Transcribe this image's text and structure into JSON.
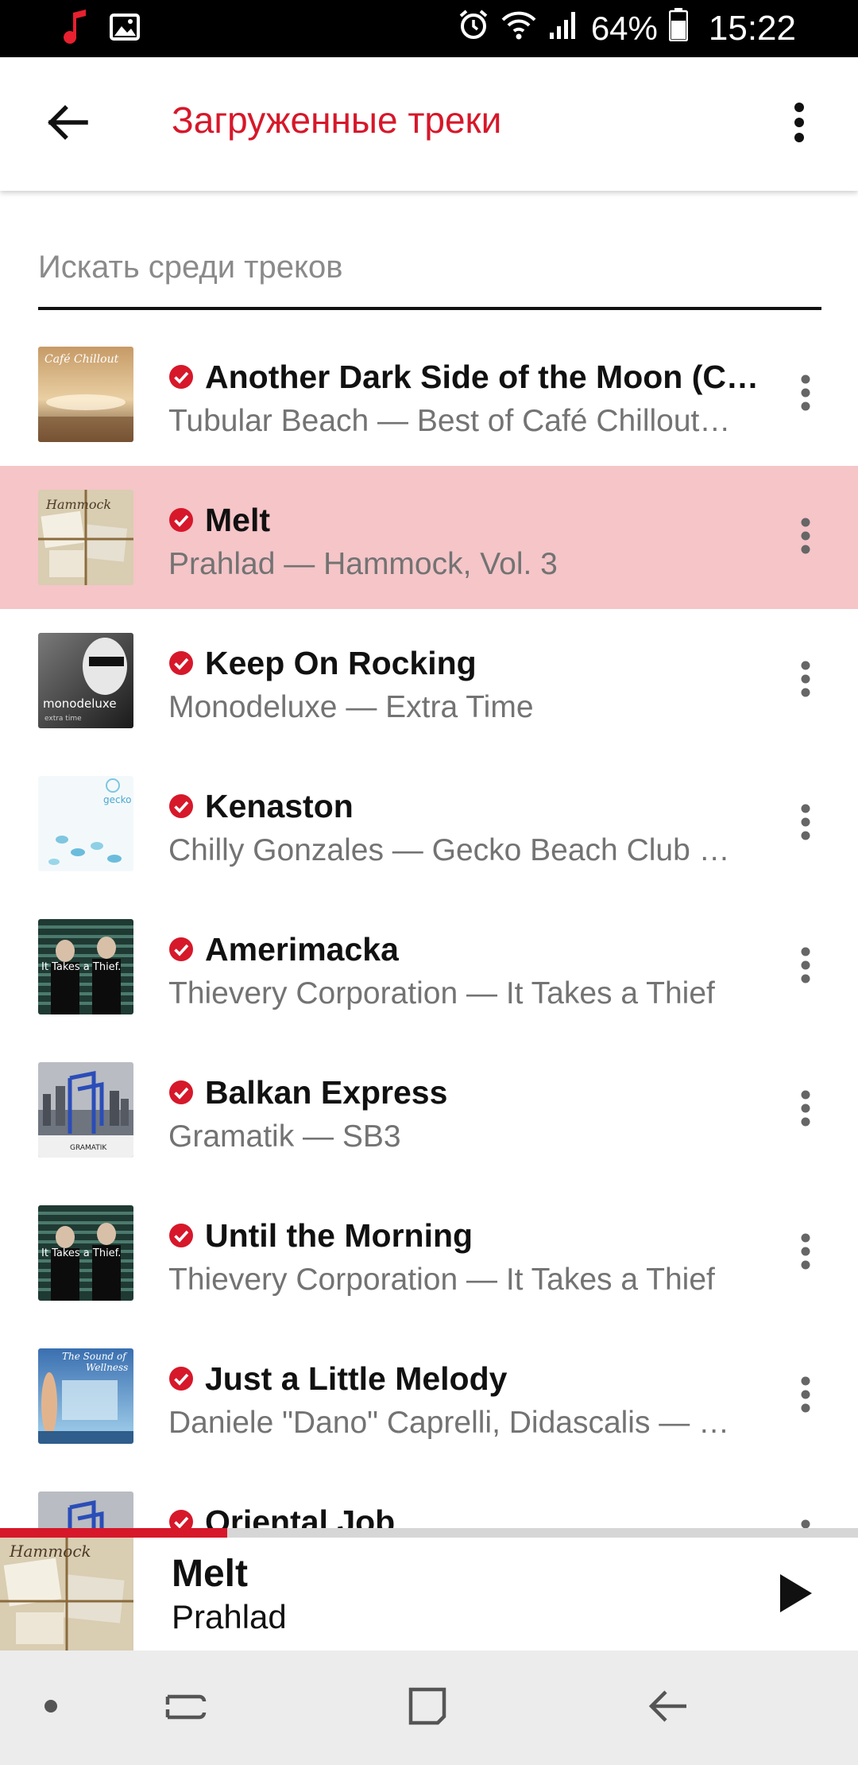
{
  "status_bar": {
    "battery_percent": "64%",
    "time": "15:22",
    "icons": [
      "music-note-icon",
      "image-icon",
      "alarm-icon",
      "wifi-icon",
      "signal-icon",
      "battery-icon"
    ]
  },
  "app_bar": {
    "title": "Загруженные треки",
    "back_icon": "arrow-left-icon",
    "menu_icon": "more-vertical-icon"
  },
  "search": {
    "placeholder": "Искать среди треков",
    "value": ""
  },
  "colors": {
    "accent": "#d6182a",
    "active_row": "#f5c5c8",
    "secondary_text": "#737373"
  },
  "tracks": [
    {
      "title": "Another Dark Side of the Moon (C…",
      "subtitle": "Tubular Beach — Best of Café Chillout…",
      "downloaded": true,
      "active": false
    },
    {
      "title": "Melt",
      "subtitle": "Prahlad — Hammock, Vol. 3",
      "downloaded": true,
      "active": true
    },
    {
      "title": "Keep On Rocking",
      "subtitle": "Monodeluxe — Extra Time",
      "downloaded": true,
      "active": false
    },
    {
      "title": "Kenaston",
      "subtitle": "Chilly Gonzales — Gecko Beach Club …",
      "downloaded": true,
      "active": false
    },
    {
      "title": "Amerimacka",
      "subtitle": "Thievery Corporation — It Takes a Thief",
      "downloaded": true,
      "active": false
    },
    {
      "title": "Balkan Express",
      "subtitle": "Gramatik — SB3",
      "downloaded": true,
      "active": false
    },
    {
      "title": "Until the Morning",
      "subtitle": "Thievery Corporation — It Takes a Thief",
      "downloaded": true,
      "active": false
    },
    {
      "title": "Just a Little Melody",
      "subtitle": "Daniele \"Dano\" Caprelli, Didascalis — …",
      "downloaded": true,
      "active": false
    },
    {
      "title": "Oriental Job",
      "subtitle": "",
      "downloaded": true,
      "active": false
    }
  ],
  "player": {
    "title": "Melt",
    "artist": "Prahlad",
    "progress_fraction": 0.265,
    "play_icon": "play-icon"
  },
  "nav_bar": {
    "items": [
      "dot-icon",
      "recent-apps-icon",
      "home-icon",
      "back-icon"
    ]
  }
}
